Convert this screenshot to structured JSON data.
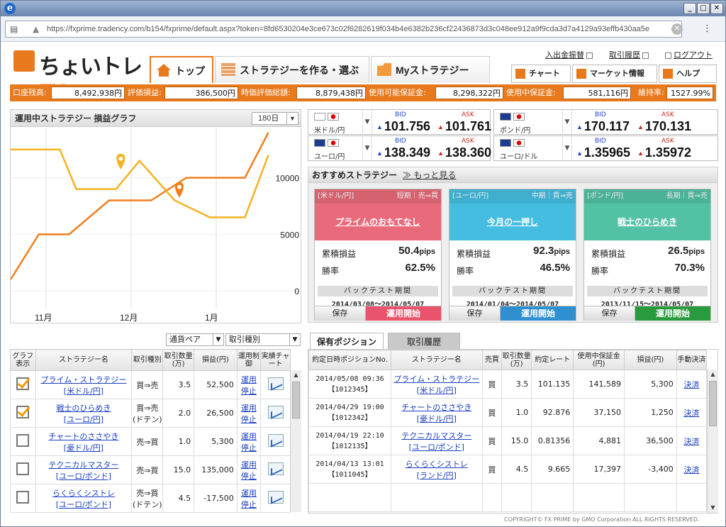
{
  "browser": {
    "url": "https://fxprime.tradency.com/b154/fxprime/default.aspx?token=8fd6530204e3ce673c02f6282619f034b4e6382b236cf22436873d3c048ee912a9f9cda3d7a4129a93effb430aa5e"
  },
  "logo": {
    "text": "ちょいトレ",
    "fx": "FX"
  },
  "nav": {
    "tabs": [
      {
        "label": "トップ"
      },
      {
        "label": "ストラテジーを作る・選ぶ"
      },
      {
        "label": "Myストラテジー"
      }
    ]
  },
  "util": {
    "deposit": "入出金振替",
    "history": "取引履歴",
    "logout": "ログアウト"
  },
  "hbtns": {
    "chart": "チャート",
    "market": "マーケット情報",
    "help": "ヘルプ"
  },
  "status": [
    {
      "label": "口座残高:",
      "value": "8,492,938円"
    },
    {
      "label": "評価損益:",
      "value": "386,500円"
    },
    {
      "label": "時価評価総額:",
      "value": "8,879,438円"
    },
    {
      "label": "使用可能保証金:",
      "value": "8,298,322円"
    },
    {
      "label": "使用中保証金:",
      "value": "581,116円"
    },
    {
      "label": "維持率:",
      "value": "1527.99%"
    }
  ],
  "graph": {
    "title": "運用中ストラテジー 損益グラフ",
    "period": "180日"
  },
  "chart_data": {
    "type": "line",
    "x": [
      "11月",
      "12月",
      "1月"
    ],
    "yticks": [
      0,
      5000,
      10000,
      15000
    ],
    "ylim": [
      0,
      16000
    ],
    "series": [
      {
        "color": "#f07f1e",
        "points": [
          [
            0,
            1000
          ],
          [
            1.2,
            5000
          ],
          [
            2.5,
            5000
          ],
          [
            4.2,
            8000
          ],
          [
            6,
            8000
          ],
          [
            7.5,
            10000
          ],
          [
            10,
            10000
          ],
          [
            11,
            14000
          ]
        ]
      },
      {
        "color": "#f5b221",
        "points": [
          [
            0,
            12500
          ],
          [
            2.1,
            12500
          ],
          [
            2.8,
            9000
          ],
          [
            4.5,
            9000
          ],
          [
            5.5,
            11500
          ],
          [
            7,
            8000
          ],
          [
            8.5,
            6500
          ],
          [
            10,
            6500
          ],
          [
            11,
            12000
          ]
        ]
      }
    ],
    "markers": [
      {
        "x": 4.7,
        "y": 11500,
        "color": "#f5b221"
      },
      {
        "x": 7.2,
        "y": 9000,
        "color": "#f07f1e"
      }
    ]
  },
  "rates": [
    {
      "pair": "米ドル/円",
      "bid": "101.756",
      "ask": "101.761"
    },
    {
      "pair": "ポンド/円",
      "bid": "170.117",
      "ask": "170.131"
    },
    {
      "pair": "ユーロ/円",
      "bid": "138.349",
      "ask": "138.360"
    },
    {
      "pair": "ユーロ/ドル",
      "bid": "1.35965",
      "ask": "1.35972"
    }
  ],
  "rate_labels": {
    "bid": "BID",
    "ask": "ASK"
  },
  "recommend": {
    "title": "おすすめストラテジー",
    "more": "もっと見る",
    "labels": {
      "pnl": "累積損益",
      "win": "勝率",
      "bt": "バックテスト期間",
      "save": "保存",
      "start": "運用開始",
      "pips": "pips"
    },
    "cards": [
      {
        "pair": "[米ドル/円]",
        "term": "短期｜売⇒買",
        "name": "プライムのおもてなし",
        "pnl": "50.4",
        "win": "62.5%",
        "period": "2014/03/08〜2014/05/07",
        "color": "#e96a7a",
        "startColor": "#e9536b"
      },
      {
        "pair": "[ユーロ/円]",
        "term": "中期｜買⇒売",
        "name": "今月の一押し",
        "pnl": "92.3",
        "win": "46.5%",
        "period": "2014/01/04〜2014/05/07",
        "color": "#44bde1",
        "startColor": "#2f8fd0"
      },
      {
        "pair": "[ポンド/円]",
        "term": "長期｜買⇒売",
        "name": "戦士のひらめき",
        "pnl": "26.5",
        "win": "70.3%",
        "period": "2013/11/15〜2014/05/07",
        "color": "#52c1a4",
        "startColor": "#2a9a3e"
      }
    ]
  },
  "filters": {
    "pair": "通貨ペア",
    "type": "取引種別"
  },
  "left_table": {
    "headers": [
      "グラフ表示",
      "ストラテジー名",
      "取引種別",
      "取引数量(万)",
      "損益(円)",
      "運用制御",
      "実績チャート"
    ],
    "rows": [
      {
        "checked": true,
        "name1": "プライム・ストラテジー",
        "name2": "[米ドル/円]",
        "type1": "買⇒売",
        "type2": "",
        "qty": "3.5",
        "pnl": "52,500",
        "ctl1": "運用",
        "ctl2": "停止"
      },
      {
        "checked": true,
        "name1": "戦士のひらめき",
        "name2": "[ユーロ/円]",
        "type1": "買⇒売",
        "type2": "(ドテン)",
        "qty": "2.0",
        "pnl": "26,500",
        "ctl1": "運用",
        "ctl2": "停止"
      },
      {
        "checked": false,
        "name1": "チャートのささやき",
        "name2": "[豪ドル/円]",
        "type1": "売⇒買",
        "type2": "",
        "qty": "1.0",
        "pnl": "5,300",
        "ctl1": "運用",
        "ctl2": "停止"
      },
      {
        "checked": false,
        "name1": "テクニカルマスター",
        "name2": "[ユーロ/ポンド]",
        "type1": "売⇒買",
        "type2": "",
        "qty": "15.0",
        "pnl": "135,000",
        "ctl1": "運用",
        "ctl2": "停止"
      },
      {
        "checked": false,
        "name1": "らくらくシストレ",
        "name2": "[ユーロ/ポンド]",
        "type1": "売⇒買",
        "type2": "(ドテン)",
        "qty": "4.5",
        "pnl": "-17,500",
        "ctl1": "運用",
        "ctl2": "停止"
      }
    ]
  },
  "right_tabs": {
    "positions": "保有ポジション",
    "history": "取引履歴"
  },
  "right_table": {
    "headers": [
      "約定日時ポジションNo.",
      "ストラテジー名",
      "売買",
      "取引数量(万)",
      "約定レート",
      "使用中保証金(円)",
      "損益(円)",
      "手動決済"
    ],
    "rows": [
      {
        "date": "2014/05/08 09:36",
        "no": "【1012345】",
        "name1": "プライム・ストラテジー",
        "name2": "[米ドル/円]",
        "side": "買",
        "qty": "3.5",
        "rate": "101.135",
        "margin": "141,589",
        "pnl": "5,300",
        "settle": "決済"
      },
      {
        "date": "2014/04/29 19:00",
        "no": "【1012342】",
        "name1": "チャートのささやき",
        "name2": "[豪ドル/円]",
        "side": "買",
        "qty": "1.0",
        "rate": "92.876",
        "margin": "37,150",
        "pnl": "1,250",
        "settle": "決済"
      },
      {
        "date": "2014/04/19 22:10",
        "no": "【1012135】",
        "name1": "テクニカルマスター",
        "name2": "[ユーロ/ポンド]",
        "side": "買",
        "qty": "15.0",
        "rate": "0.81356",
        "margin": "4,881",
        "pnl": "36,500",
        "settle": "決済"
      },
      {
        "date": "2014/04/13 13:01",
        "no": "【1011045】",
        "name1": "らくらくシストレ",
        "name2": "[ランド/円]",
        "side": "買",
        "qty": "4.5",
        "rate": "9.665",
        "margin": "17,397",
        "pnl": "-3,400",
        "settle": "決済"
      }
    ]
  },
  "copyright": "COPYRIGHT© FX PRIME by GMO Corporation ALL RIGHTS RESERVED."
}
